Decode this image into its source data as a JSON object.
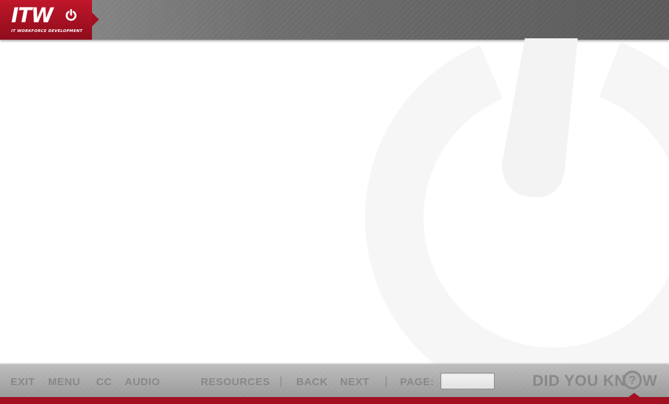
{
  "header": {
    "logo_text": "ITW",
    "logo_subtitle": "IT WORKFORCE DEVELOPMENT",
    "brand_color": "#b0142a"
  },
  "toolbar": {
    "exit_label": "EXIT",
    "menu_label": "MENU",
    "cc_label": "CC",
    "audio_label": "AUDIO",
    "resources_label": "RESOURCES",
    "back_label": "BACK",
    "next_label": "NEXT",
    "page_label": "PAGE:",
    "page_value": "",
    "separator": "|",
    "did_you_know_label": "DID YOU KN",
    "did_you_know_q": "?",
    "did_you_know_end": "W"
  },
  "icons": {
    "logo_icon": "power-icon",
    "watermark_icon": "power-icon",
    "did_you_know_icon": "question-circle-icon"
  }
}
